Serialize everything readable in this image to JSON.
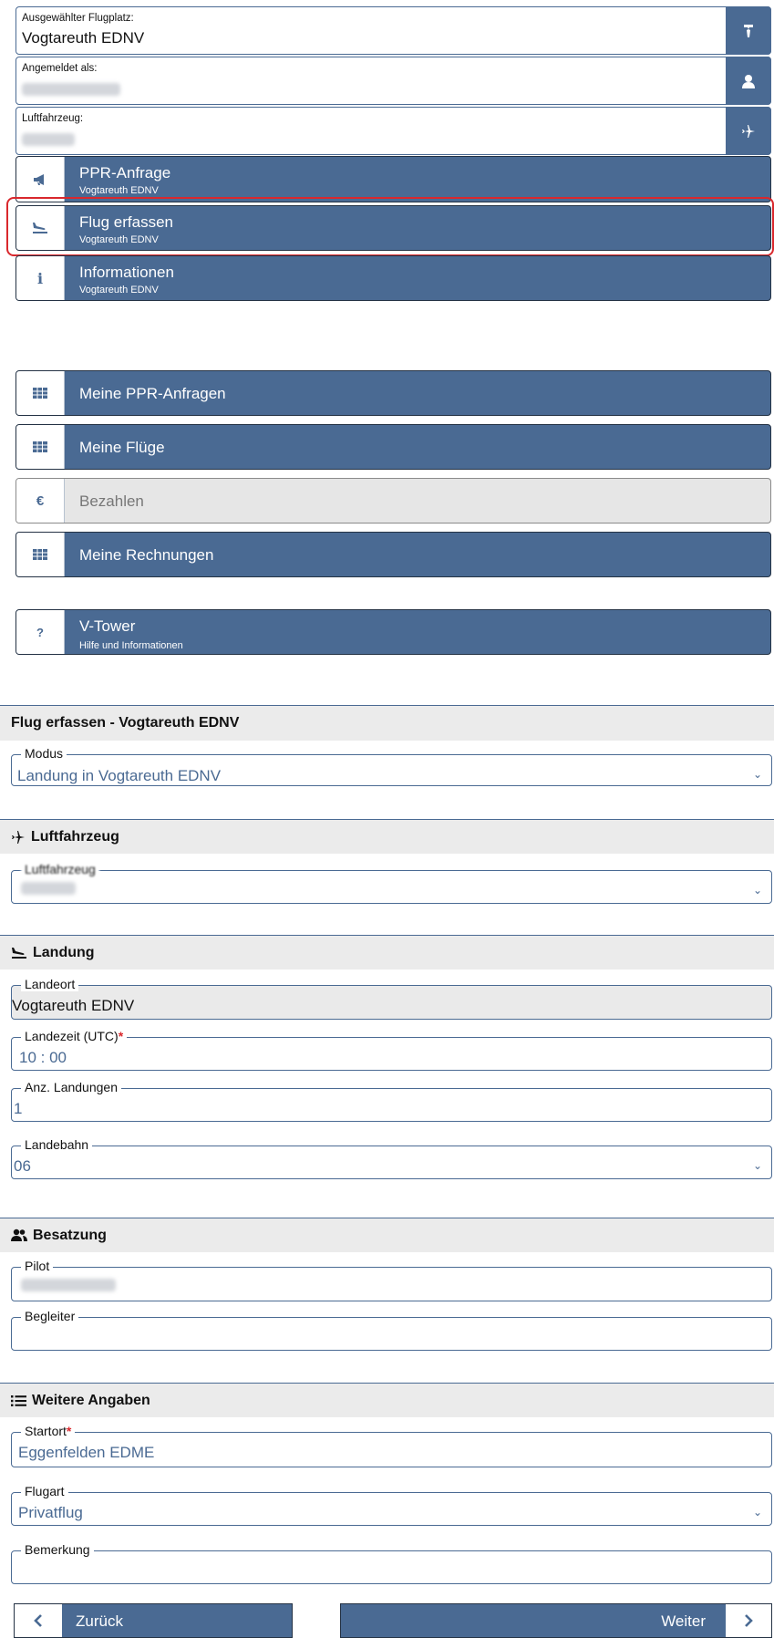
{
  "airport": {
    "label": "Ausgewählter Flugplatz:",
    "value": "Vogtareuth EDNV"
  },
  "user": {
    "label": "Angemeldet als:"
  },
  "aircraft_info": {
    "label": "Luftfahrzeug:"
  },
  "menu": [
    {
      "title": "PPR-Anfrage",
      "subtitle": "Vogtareuth EDNV",
      "icon": "megaphone-icon"
    },
    {
      "title": "Flug erfassen",
      "subtitle": "Vogtareuth EDNV",
      "icon": "landing-icon"
    },
    {
      "title": "Informationen",
      "subtitle": "Vogtareuth EDNV",
      "icon": "info-icon"
    },
    {
      "title": "Meine PPR-Anfragen",
      "icon": "table-icon"
    },
    {
      "title": "Meine Flüge",
      "icon": "table-icon"
    },
    {
      "title": "Bezahlen",
      "icon": "euro-icon",
      "icon_text": "€"
    },
    {
      "title": "Meine Rechnungen",
      "icon": "table-icon"
    },
    {
      "title": "V-Tower",
      "subtitle": "Hilfe und Informationen",
      "icon": "question-icon",
      "icon_text": "?"
    }
  ],
  "form": {
    "title": "Flug erfassen - Vogtareuth EDNV",
    "modus": {
      "legend": "Modus",
      "value": "Landung in Vogtareuth EDNV"
    },
    "sections": {
      "aircraft": "Luftfahrzeug",
      "landing": "Landung",
      "crew": "Besatzung",
      "more": "Weitere Angaben"
    },
    "aircraft_field": {
      "legend": "Luftfahrzeug"
    },
    "landeort": {
      "legend": "Landeort",
      "value": "Vogtareuth EDNV"
    },
    "landezeit": {
      "legend": "Landezeit (UTC)",
      "value": "10 : 00"
    },
    "landungen": {
      "legend": "Anz. Landungen",
      "value": "1"
    },
    "landebahn": {
      "legend": "Landebahn",
      "value": "06"
    },
    "pilot": {
      "legend": "Pilot"
    },
    "begleiter": {
      "legend": "Begleiter"
    },
    "startort": {
      "legend": "Startort",
      "value": "Eggenfelden EDME"
    },
    "flugart": {
      "legend": "Flugart",
      "value": "Privatflug"
    },
    "bemerkung": {
      "legend": "Bemerkung"
    }
  },
  "nav": {
    "back": "Zurück",
    "next": "Weiter"
  },
  "required_mark": "*",
  "chevron": "⌄",
  "colors": {
    "primary": "#4a6a93",
    "highlight": "#d9282d",
    "section_bg": "#ebebeb"
  }
}
